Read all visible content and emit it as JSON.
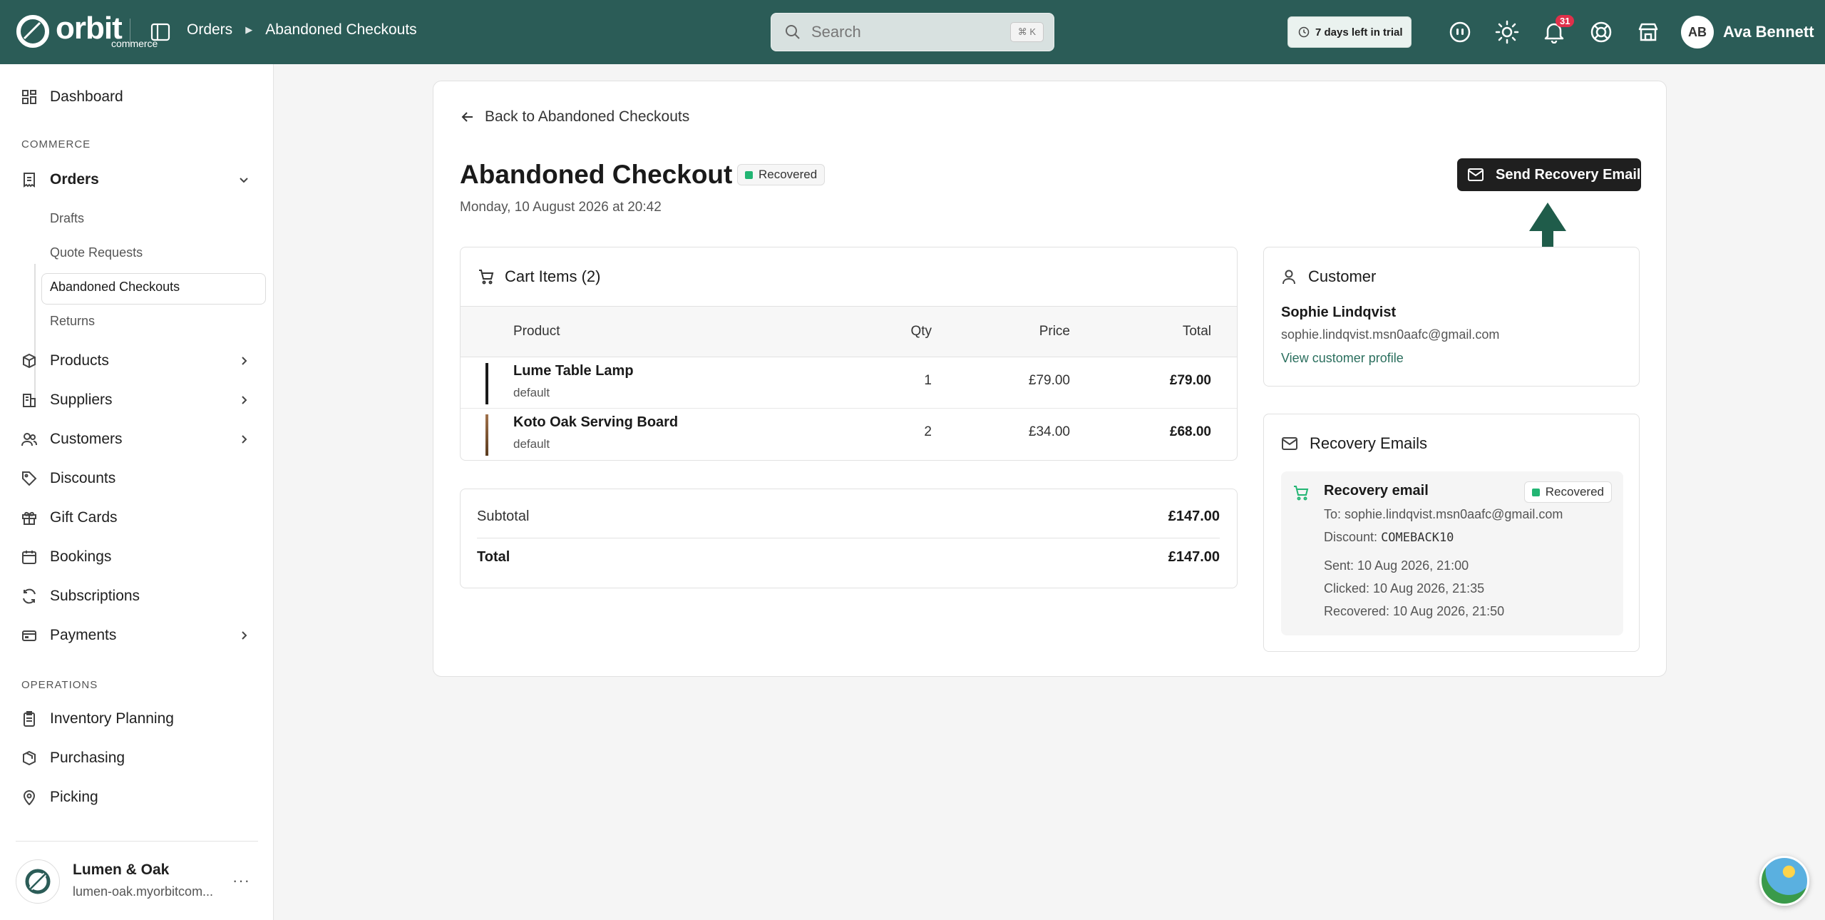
{
  "topbar": {
    "logo_text": "orbit",
    "logo_sub": "commerce",
    "breadcrumb": [
      "Orders",
      "Abandoned Checkouts"
    ],
    "search_placeholder": "Search",
    "search_shortcut": "⌘ K",
    "trial_text": "7 days left in trial",
    "notifications_count": "31",
    "user_initials": "AB",
    "user_name": "Ava Bennett"
  },
  "sidebar": {
    "dashboard": "Dashboard",
    "section_commerce": "COMMERCE",
    "orders": "Orders",
    "order_subitems": [
      "Drafts",
      "Quote Requests",
      "Abandoned Checkouts",
      "Returns"
    ],
    "products": "Products",
    "suppliers": "Suppliers",
    "customers": "Customers",
    "discounts": "Discounts",
    "gift_cards": "Gift Cards",
    "bookings": "Bookings",
    "subscriptions": "Subscriptions",
    "payments": "Payments",
    "section_operations": "OPERATIONS",
    "inventory_planning": "Inventory Planning",
    "purchasing": "Purchasing",
    "picking": "Picking",
    "store_name": "Lumen & Oak",
    "store_url": "lumen-oak.myorbitcom..."
  },
  "page": {
    "back_label": "Back to Abandoned Checkouts",
    "title": "Abandoned Checkout",
    "status": "Recovered",
    "date": "Monday, 10 August 2026 at 20:42",
    "send_button": "Send Recovery Email"
  },
  "cart": {
    "title": "Cart Items (2)",
    "columns": {
      "product": "Product",
      "qty": "Qty",
      "price": "Price",
      "total": "Total"
    },
    "rows": [
      {
        "name": "Lume Table Lamp",
        "variant": "default",
        "qty": "1",
        "price": "£79.00",
        "total": "£79.00"
      },
      {
        "name": "Koto Oak Serving Board",
        "variant": "default",
        "qty": "2",
        "price": "£34.00",
        "total": "£68.00"
      }
    ]
  },
  "summary": {
    "subtotal_label": "Subtotal",
    "subtotal_value": "£147.00",
    "total_label": "Total",
    "total_value": "£147.00"
  },
  "customer": {
    "title": "Customer",
    "name": "Sophie Lindqvist",
    "email": "sophie.lindqvist.msn0aafc@gmail.com",
    "profile_link": "View customer profile"
  },
  "recovery": {
    "title": "Recovery Emails",
    "item_title": "Recovery email",
    "item_status": "Recovered",
    "to_line": "To: sophie.lindqvist.msn0aafc@gmail.com",
    "discount_label": "Discount:",
    "discount_code": "COMEBACK10",
    "sent": "Sent: 10 Aug 2026, 21:00",
    "clicked": "Clicked: 10 Aug 2026, 21:35",
    "recovered": "Recovered: 10 Aug 2026, 21:50"
  },
  "colors": {
    "topbar": "#2b5c57",
    "status_green": "#22b573",
    "annotation_arrow": "#1f5c4a",
    "link": "#2b6f5e"
  }
}
